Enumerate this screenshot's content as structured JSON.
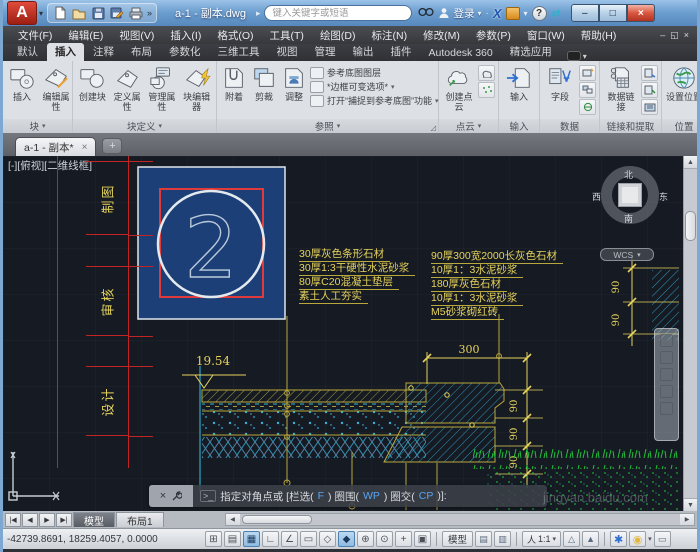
{
  "ui": {
    "caret": "▾",
    "more": "»",
    "arrow": "▸",
    "plus": "+",
    "left": "◀",
    "right": "▶",
    "up": "▲",
    "down": "▼",
    "launcher": "◿",
    "min": "–",
    "max": "□",
    "close": "×",
    "restore": "◱",
    "dot": "·",
    "sync": "⇄",
    "nav_first": "|◀",
    "nav_last": "▶|"
  },
  "titlebar": {
    "doc_title": "a-1 - 副本.dwg",
    "search_placeholder": "键入关键字或短语",
    "signin": "登录",
    "exchange": "X",
    "help": "?"
  },
  "menus": [
    "文件(F)",
    "编辑(E)",
    "视图(V)",
    "插入(I)",
    "格式(O)",
    "工具(T)",
    "绘图(D)",
    "标注(N)",
    "修改(M)",
    "参数(P)",
    "窗口(W)",
    "帮助(H)"
  ],
  "ribbon_tabs": [
    {
      "label": "默认"
    },
    {
      "label": "插入"
    },
    {
      "label": "注释"
    },
    {
      "label": "布局"
    },
    {
      "label": "参数化"
    },
    {
      "label": "三维工具"
    },
    {
      "label": "视图"
    },
    {
      "label": "管理"
    },
    {
      "label": "输出"
    },
    {
      "label": "插件"
    },
    {
      "label": "Autodesk 360"
    },
    {
      "label": "精选应用"
    }
  ],
  "ribbon": {
    "block": {
      "label": "块",
      "insert": "插入",
      "edit_attr": "编辑属性"
    },
    "blockdef": {
      "label": "块定义",
      "create": "创建块",
      "def_attr": "定义属性",
      "manage_attr": "管理属性",
      "editor": "块编辑器"
    },
    "ref": {
      "label": "参照",
      "attach": "附着",
      "clip": "剪裁",
      "adjust": "调整",
      "row1": "参考底图图层",
      "row2": "*边框可变选项*",
      "row3": "打开“捕捉到参考底图”功能"
    },
    "pointcloud": {
      "label": "点云",
      "create": "创建点云"
    },
    "import": {
      "label": "输入",
      "import_btn": "输入"
    },
    "data": {
      "label": "数据",
      "field": "字段"
    },
    "link": {
      "label": "链接和提取",
      "datalink": "数据链接"
    },
    "location": {
      "label": "位置",
      "setloc": "设置位置"
    }
  },
  "file_tab": {
    "title": "a-1 - 副本*"
  },
  "canvas": {
    "viewport_label": "[-][俯视][二维线框]",
    "titleblock": [
      "制图",
      "审核",
      "设计"
    ],
    "ann_left": [
      "30厚灰色条形石材",
      "30厚1:3干硬性水泥砂浆",
      "80厚C20混凝土垫层",
      "素土人工夯实"
    ],
    "ann_right": [
      "90厚300宽2000长灰色石材",
      "10厚1：3水泥砂浆",
      "180厚灰色石材",
      "10厚1：3水泥砂浆",
      "M5砂浆砌红砖"
    ],
    "block_number": "2",
    "dims": {
      "elevation": "19.54",
      "width": "300",
      "chain1": [
        "90",
        "90",
        "90"
      ],
      "chain2": [
        "90",
        "90"
      ]
    },
    "viewcube": {
      "n": "北",
      "s": "南",
      "w": "西",
      "e": "东",
      "wcs": "WCS"
    },
    "ucs": {
      "x": "X",
      "y": "Y"
    },
    "watermark": "jingyan.baidu.com"
  },
  "command": {
    "close": "×",
    "prompt": ">_",
    "parts": [
      "指定对角点或 [栏选(",
      "F",
      ") 圈围(",
      "WP",
      ") 圈交(",
      "CP",
      ")]:"
    ]
  },
  "layoutbar": {
    "nav": [
      "|◀",
      "◀",
      "▶",
      "▶|"
    ],
    "tabs": [
      {
        "label": "模型"
      },
      {
        "label": "布局1"
      }
    ]
  },
  "statusbar": {
    "coords": "-42739.8691, 18259.4057, 0.0000",
    "toggles": [
      {
        "g": "⊞"
      },
      {
        "g": "▤"
      },
      {
        "g": "▦"
      },
      {
        "g": "∟"
      },
      {
        "g": "∠"
      },
      {
        "g": "▭"
      },
      {
        "g": "◇"
      },
      {
        "g": "◆"
      },
      {
        "g": "⊕"
      },
      {
        "g": "⊙"
      },
      {
        "g": "+"
      },
      {
        "g": "▣"
      }
    ],
    "model": "模型",
    "person": "人",
    "scale": "1:1",
    "tri1": "△",
    "tri2": "▲",
    "gear": "✱",
    "bulb": "◉",
    "clean": "▭",
    "page1": "▤",
    "page2": "▥"
  },
  "colors": {
    "cad_yellow": "#e6d35c",
    "cad_red": "#cc2626",
    "cad_cyan": "#2fa8c8",
    "cad_green": "#23bd3a",
    "select_fill": "#1c3f77",
    "frame_blue": "#7da8d2"
  }
}
